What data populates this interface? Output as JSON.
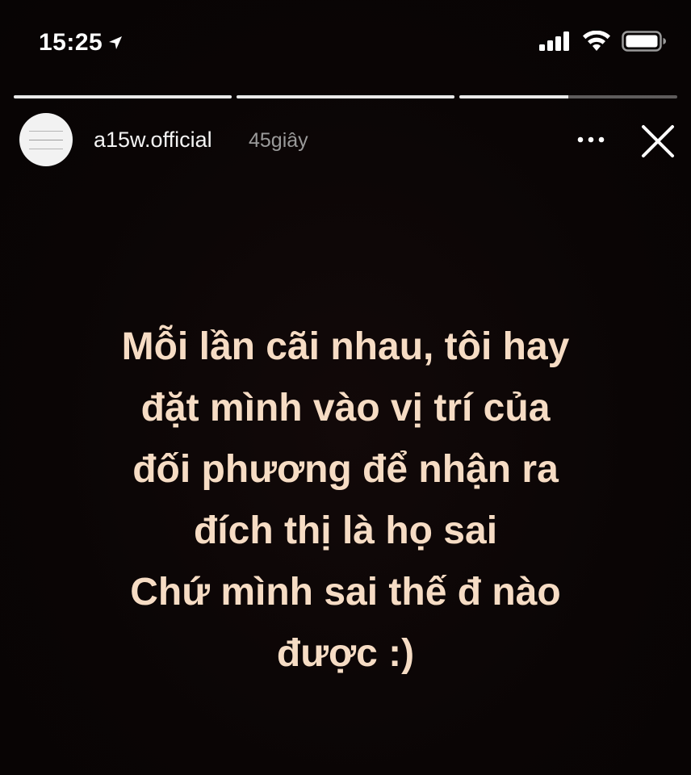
{
  "status_bar": {
    "time": "15:25",
    "location_icon": "location-arrow-icon",
    "signal_icon": "cellular-signal-icon",
    "wifi_icon": "wifi-icon",
    "battery_icon": "battery-icon"
  },
  "story": {
    "progress_fractions": [
      1,
      1,
      0.5
    ],
    "username": "a15w.official",
    "time_ago": "45giây",
    "more_icon": "more-dots-icon",
    "close_icon": "close-icon",
    "lines": [
      "Mỗi lần cãi nhau, tôi hay",
      "đặt mình vào vị trí của",
      "đối phương để nhận ra",
      "đích thị là họ sai",
      "Chứ mình sai thế đ nào",
      "được :)"
    ]
  },
  "colors": {
    "background": "#0b0606",
    "text": "#f6dcc4",
    "timestamp": "#9a9a9a"
  }
}
